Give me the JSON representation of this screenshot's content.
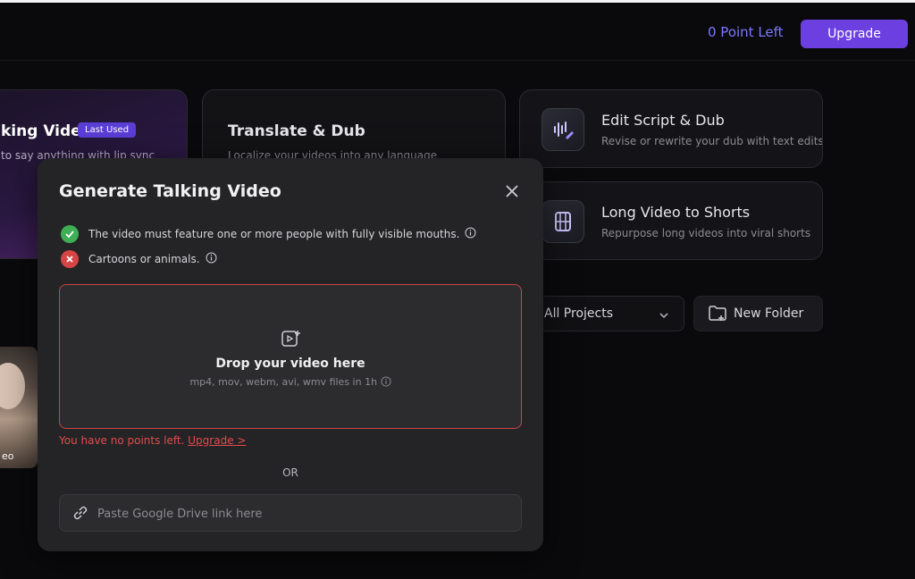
{
  "header": {
    "points_label": "0 Point Left",
    "upgrade_label": "Upgrade"
  },
  "cards": {
    "talking": {
      "title": "king Video",
      "badge": "Last Used",
      "subtitle": "to say anything with lip sync"
    },
    "translate": {
      "title": "Translate & Dub",
      "subtitle": "Localize your videos into any language"
    },
    "edit_script": {
      "title": "Edit Script & Dub",
      "subtitle": "Revise or rewrite your dub with text edits",
      "icon": "waveform-edit-icon"
    },
    "long_video": {
      "title": "Long Video to Shorts",
      "subtitle": "Repurpose long videos into viral shorts",
      "icon": "film-strip-icon"
    }
  },
  "projects": {
    "filter_label": "All Projects",
    "new_folder_label": "New Folder"
  },
  "thumbnail": {
    "caption": "eo"
  },
  "modal": {
    "title": "Generate Talking Video",
    "rules": [
      {
        "text": "The video must feature one or more people with fully visible mouths.",
        "status": "allowed"
      },
      {
        "text": "Cartoons or animals.",
        "status": "not-allowed"
      }
    ],
    "dropzone": {
      "main": "Drop your video here",
      "hint": "mp4, mov, webm, avi, wmv files in 1h"
    },
    "warning": {
      "text": "You have no points left.",
      "link": "Upgrade >"
    },
    "or_label": "OR",
    "gdrive": {
      "placeholder": "Paste Google Drive link here",
      "value": ""
    }
  },
  "colors": {
    "accent": "#6b3fe0",
    "points": "#7a78ff",
    "error": "#e24c4c",
    "success": "#3fae55"
  }
}
